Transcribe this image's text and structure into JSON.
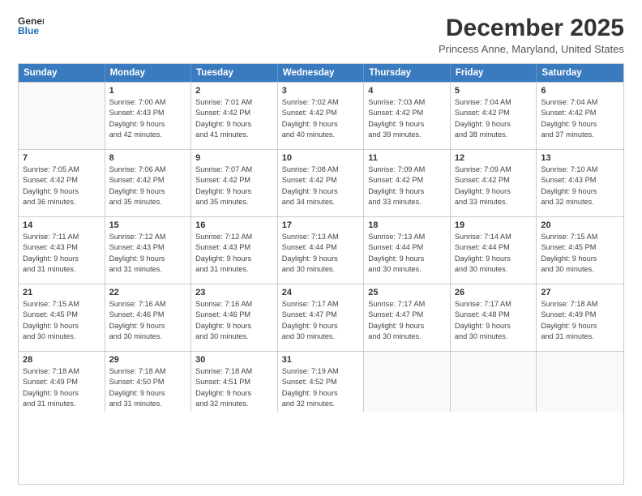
{
  "logo": {
    "line1": "General",
    "line2": "Blue"
  },
  "title": "December 2025",
  "subtitle": "Princess Anne, Maryland, United States",
  "header_days": [
    "Sunday",
    "Monday",
    "Tuesday",
    "Wednesday",
    "Thursday",
    "Friday",
    "Saturday"
  ],
  "rows": [
    [
      {
        "num": "",
        "info": ""
      },
      {
        "num": "1",
        "info": "Sunrise: 7:00 AM\nSunset: 4:43 PM\nDaylight: 9 hours\nand 42 minutes."
      },
      {
        "num": "2",
        "info": "Sunrise: 7:01 AM\nSunset: 4:42 PM\nDaylight: 9 hours\nand 41 minutes."
      },
      {
        "num": "3",
        "info": "Sunrise: 7:02 AM\nSunset: 4:42 PM\nDaylight: 9 hours\nand 40 minutes."
      },
      {
        "num": "4",
        "info": "Sunrise: 7:03 AM\nSunset: 4:42 PM\nDaylight: 9 hours\nand 39 minutes."
      },
      {
        "num": "5",
        "info": "Sunrise: 7:04 AM\nSunset: 4:42 PM\nDaylight: 9 hours\nand 38 minutes."
      },
      {
        "num": "6",
        "info": "Sunrise: 7:04 AM\nSunset: 4:42 PM\nDaylight: 9 hours\nand 37 minutes."
      }
    ],
    [
      {
        "num": "7",
        "info": "Sunrise: 7:05 AM\nSunset: 4:42 PM\nDaylight: 9 hours\nand 36 minutes."
      },
      {
        "num": "8",
        "info": "Sunrise: 7:06 AM\nSunset: 4:42 PM\nDaylight: 9 hours\nand 35 minutes."
      },
      {
        "num": "9",
        "info": "Sunrise: 7:07 AM\nSunset: 4:42 PM\nDaylight: 9 hours\nand 35 minutes."
      },
      {
        "num": "10",
        "info": "Sunrise: 7:08 AM\nSunset: 4:42 PM\nDaylight: 9 hours\nand 34 minutes."
      },
      {
        "num": "11",
        "info": "Sunrise: 7:09 AM\nSunset: 4:42 PM\nDaylight: 9 hours\nand 33 minutes."
      },
      {
        "num": "12",
        "info": "Sunrise: 7:09 AM\nSunset: 4:42 PM\nDaylight: 9 hours\nand 33 minutes."
      },
      {
        "num": "13",
        "info": "Sunrise: 7:10 AM\nSunset: 4:43 PM\nDaylight: 9 hours\nand 32 minutes."
      }
    ],
    [
      {
        "num": "14",
        "info": "Sunrise: 7:11 AM\nSunset: 4:43 PM\nDaylight: 9 hours\nand 31 minutes."
      },
      {
        "num": "15",
        "info": "Sunrise: 7:12 AM\nSunset: 4:43 PM\nDaylight: 9 hours\nand 31 minutes."
      },
      {
        "num": "16",
        "info": "Sunrise: 7:12 AM\nSunset: 4:43 PM\nDaylight: 9 hours\nand 31 minutes."
      },
      {
        "num": "17",
        "info": "Sunrise: 7:13 AM\nSunset: 4:44 PM\nDaylight: 9 hours\nand 30 minutes."
      },
      {
        "num": "18",
        "info": "Sunrise: 7:13 AM\nSunset: 4:44 PM\nDaylight: 9 hours\nand 30 minutes."
      },
      {
        "num": "19",
        "info": "Sunrise: 7:14 AM\nSunset: 4:44 PM\nDaylight: 9 hours\nand 30 minutes."
      },
      {
        "num": "20",
        "info": "Sunrise: 7:15 AM\nSunset: 4:45 PM\nDaylight: 9 hours\nand 30 minutes."
      }
    ],
    [
      {
        "num": "21",
        "info": "Sunrise: 7:15 AM\nSunset: 4:45 PM\nDaylight: 9 hours\nand 30 minutes."
      },
      {
        "num": "22",
        "info": "Sunrise: 7:16 AM\nSunset: 4:46 PM\nDaylight: 9 hours\nand 30 minutes."
      },
      {
        "num": "23",
        "info": "Sunrise: 7:16 AM\nSunset: 4:46 PM\nDaylight: 9 hours\nand 30 minutes."
      },
      {
        "num": "24",
        "info": "Sunrise: 7:17 AM\nSunset: 4:47 PM\nDaylight: 9 hours\nand 30 minutes."
      },
      {
        "num": "25",
        "info": "Sunrise: 7:17 AM\nSunset: 4:47 PM\nDaylight: 9 hours\nand 30 minutes."
      },
      {
        "num": "26",
        "info": "Sunrise: 7:17 AM\nSunset: 4:48 PM\nDaylight: 9 hours\nand 30 minutes."
      },
      {
        "num": "27",
        "info": "Sunrise: 7:18 AM\nSunset: 4:49 PM\nDaylight: 9 hours\nand 31 minutes."
      }
    ],
    [
      {
        "num": "28",
        "info": "Sunrise: 7:18 AM\nSunset: 4:49 PM\nDaylight: 9 hours\nand 31 minutes."
      },
      {
        "num": "29",
        "info": "Sunrise: 7:18 AM\nSunset: 4:50 PM\nDaylight: 9 hours\nand 31 minutes."
      },
      {
        "num": "30",
        "info": "Sunrise: 7:18 AM\nSunset: 4:51 PM\nDaylight: 9 hours\nand 32 minutes."
      },
      {
        "num": "31",
        "info": "Sunrise: 7:19 AM\nSunset: 4:52 PM\nDaylight: 9 hours\nand 32 minutes."
      },
      {
        "num": "",
        "info": ""
      },
      {
        "num": "",
        "info": ""
      },
      {
        "num": "",
        "info": ""
      }
    ]
  ]
}
